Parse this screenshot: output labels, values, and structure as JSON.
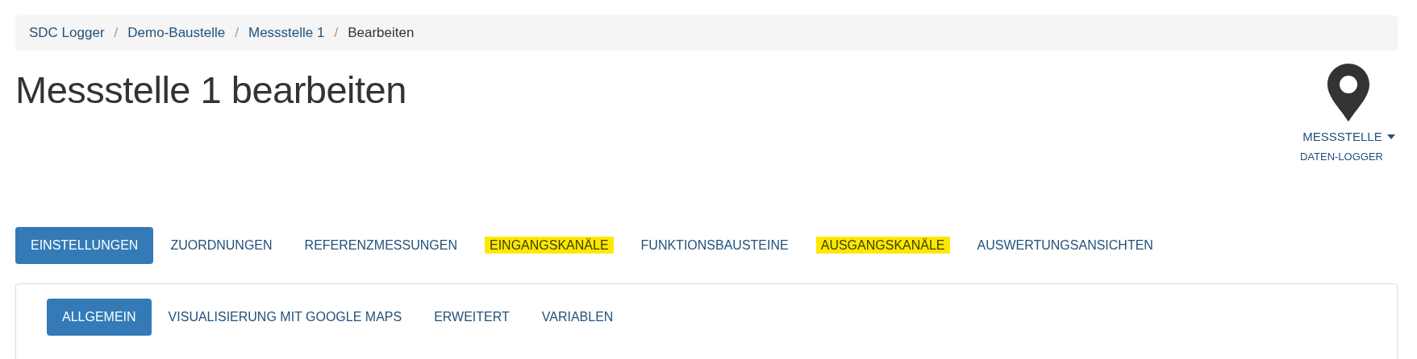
{
  "breadcrumb": [
    {
      "label": "SDC Logger",
      "active": false
    },
    {
      "label": "Demo-Baustelle",
      "active": false
    },
    {
      "label": "Messstelle 1",
      "active": false
    },
    {
      "label": "Bearbeiten",
      "active": true
    }
  ],
  "breadcrumb_separator": "/",
  "title": "Messstelle 1 bearbeiten",
  "context": {
    "menu": "MESSSTELLE",
    "sub": "DATEN-LOGGER"
  },
  "tabs": [
    {
      "label": "EINSTELLUNGEN",
      "selected": true,
      "highlighted": false
    },
    {
      "label": "ZUORDNUNGEN",
      "selected": false,
      "highlighted": false
    },
    {
      "label": "REFERENZMESSUNGEN",
      "selected": false,
      "highlighted": false
    },
    {
      "label": "EINGANGSKANÄLE",
      "selected": false,
      "highlighted": true
    },
    {
      "label": "FUNKTIONSBAUSTEINE",
      "selected": false,
      "highlighted": false
    },
    {
      "label": "AUSGANGSKANÄLE",
      "selected": false,
      "highlighted": true
    },
    {
      "label": "AUSWERTUNGSANSICHTEN",
      "selected": false,
      "highlighted": false
    }
  ],
  "subtabs": [
    {
      "label": "ALLGEMEIN",
      "selected": true
    },
    {
      "label": "VISUALISIERUNG MIT GOOGLE MAPS",
      "selected": false
    },
    {
      "label": "ERWEITERT",
      "selected": false
    },
    {
      "label": "VARIABLEN",
      "selected": false
    }
  ]
}
